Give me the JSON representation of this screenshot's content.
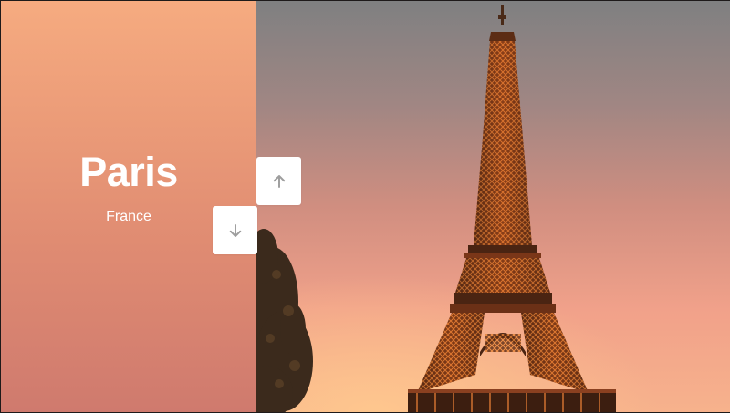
{
  "slide": {
    "city": "Paris",
    "country": "France"
  },
  "controls": {
    "up_icon": "arrow-up-icon",
    "down_icon": "arrow-down-icon"
  },
  "colors": {
    "panel_top": "#f6ab80",
    "panel_bottom": "#cf7a6e",
    "button_bg": "#ffffff",
    "icon_color": "#9e9e9e"
  },
  "image": {
    "subject": "eiffel-tower-sunset"
  }
}
